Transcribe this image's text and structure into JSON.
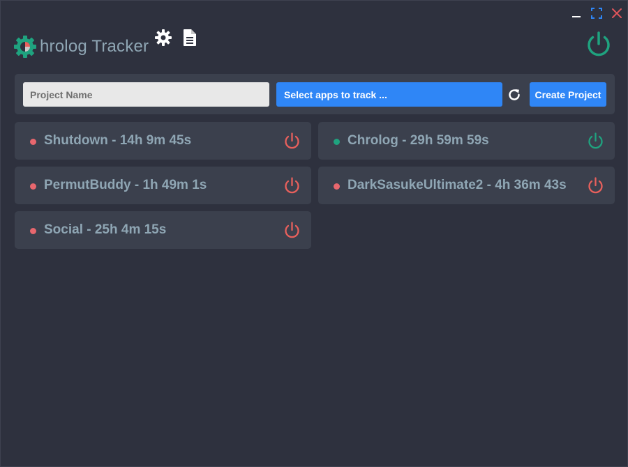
{
  "window": {
    "controls": {
      "minimize_icon": "minimize-icon",
      "maximize_icon": "maximize-icon",
      "close_icon": "close-icon",
      "close_color": "#e0555b",
      "maximize_color": "#2f86f6"
    }
  },
  "header": {
    "title": "hrolog Tracker",
    "logo_icon": "gear-clock-logo",
    "settings_icon": "gear-icon",
    "log_icon": "document-icon",
    "global_power_icon": "power-icon",
    "global_power_color": "#1fa37f"
  },
  "toolbar": {
    "project_name_placeholder": "Project Name",
    "project_name_value": "",
    "app_select_label": "Select apps to track ...",
    "refresh_icon": "refresh-icon",
    "create_button_label": "Create Project"
  },
  "colors": {
    "active": "#1fa37f",
    "inactive": "#e8605c",
    "inactive_dot": "#e8676e",
    "accent": "#2f86f6"
  },
  "projects": [
    {
      "label": "Shutdown - 14h 9m 45s",
      "status": "inactive"
    },
    {
      "label": "Chrolog - 29h 59m 59s",
      "status": "active"
    },
    {
      "label": "PermutBuddy - 1h 49m 1s",
      "status": "inactive"
    },
    {
      "label": "DarkSasukeUltimate2 - 4h 36m 43s",
      "status": "inactive"
    },
    {
      "label": "Social - 25h 4m 15s",
      "status": "inactive"
    }
  ]
}
